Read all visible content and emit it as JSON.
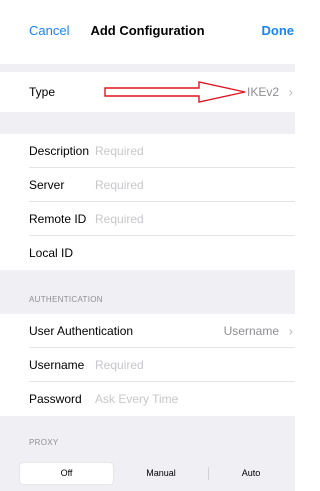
{
  "navbar": {
    "cancel_label": "Cancel",
    "title": "Add Configuration",
    "done_label": "Done"
  },
  "type_row": {
    "label": "Type",
    "value": "IKEv2"
  },
  "annotation_color": "#e0141e",
  "fields": {
    "description": {
      "label": "Description",
      "placeholder": "Required"
    },
    "server": {
      "label": "Server",
      "placeholder": "Required"
    },
    "remote_id": {
      "label": "Remote ID",
      "placeholder": "Required"
    },
    "local_id": {
      "label": "Local ID",
      "placeholder": ""
    }
  },
  "auth_section": {
    "header": "AUTHENTICATION",
    "user_auth": {
      "label": "User Authentication",
      "value": "Username"
    },
    "username": {
      "label": "Username",
      "placeholder": "Required"
    },
    "password": {
      "label": "Password",
      "placeholder": "Ask Every Time"
    }
  },
  "proxy_section": {
    "header": "PROXY",
    "options": [
      "Off",
      "Manual",
      "Auto"
    ],
    "selected": "Off"
  },
  "colors": {
    "accent": "#1a82f2",
    "group_background": "#efeff4",
    "placeholder": "#c7c7cc",
    "secondary_text": "#8e8e93"
  },
  "icons": {
    "disclosure": "chevron-right-icon"
  }
}
